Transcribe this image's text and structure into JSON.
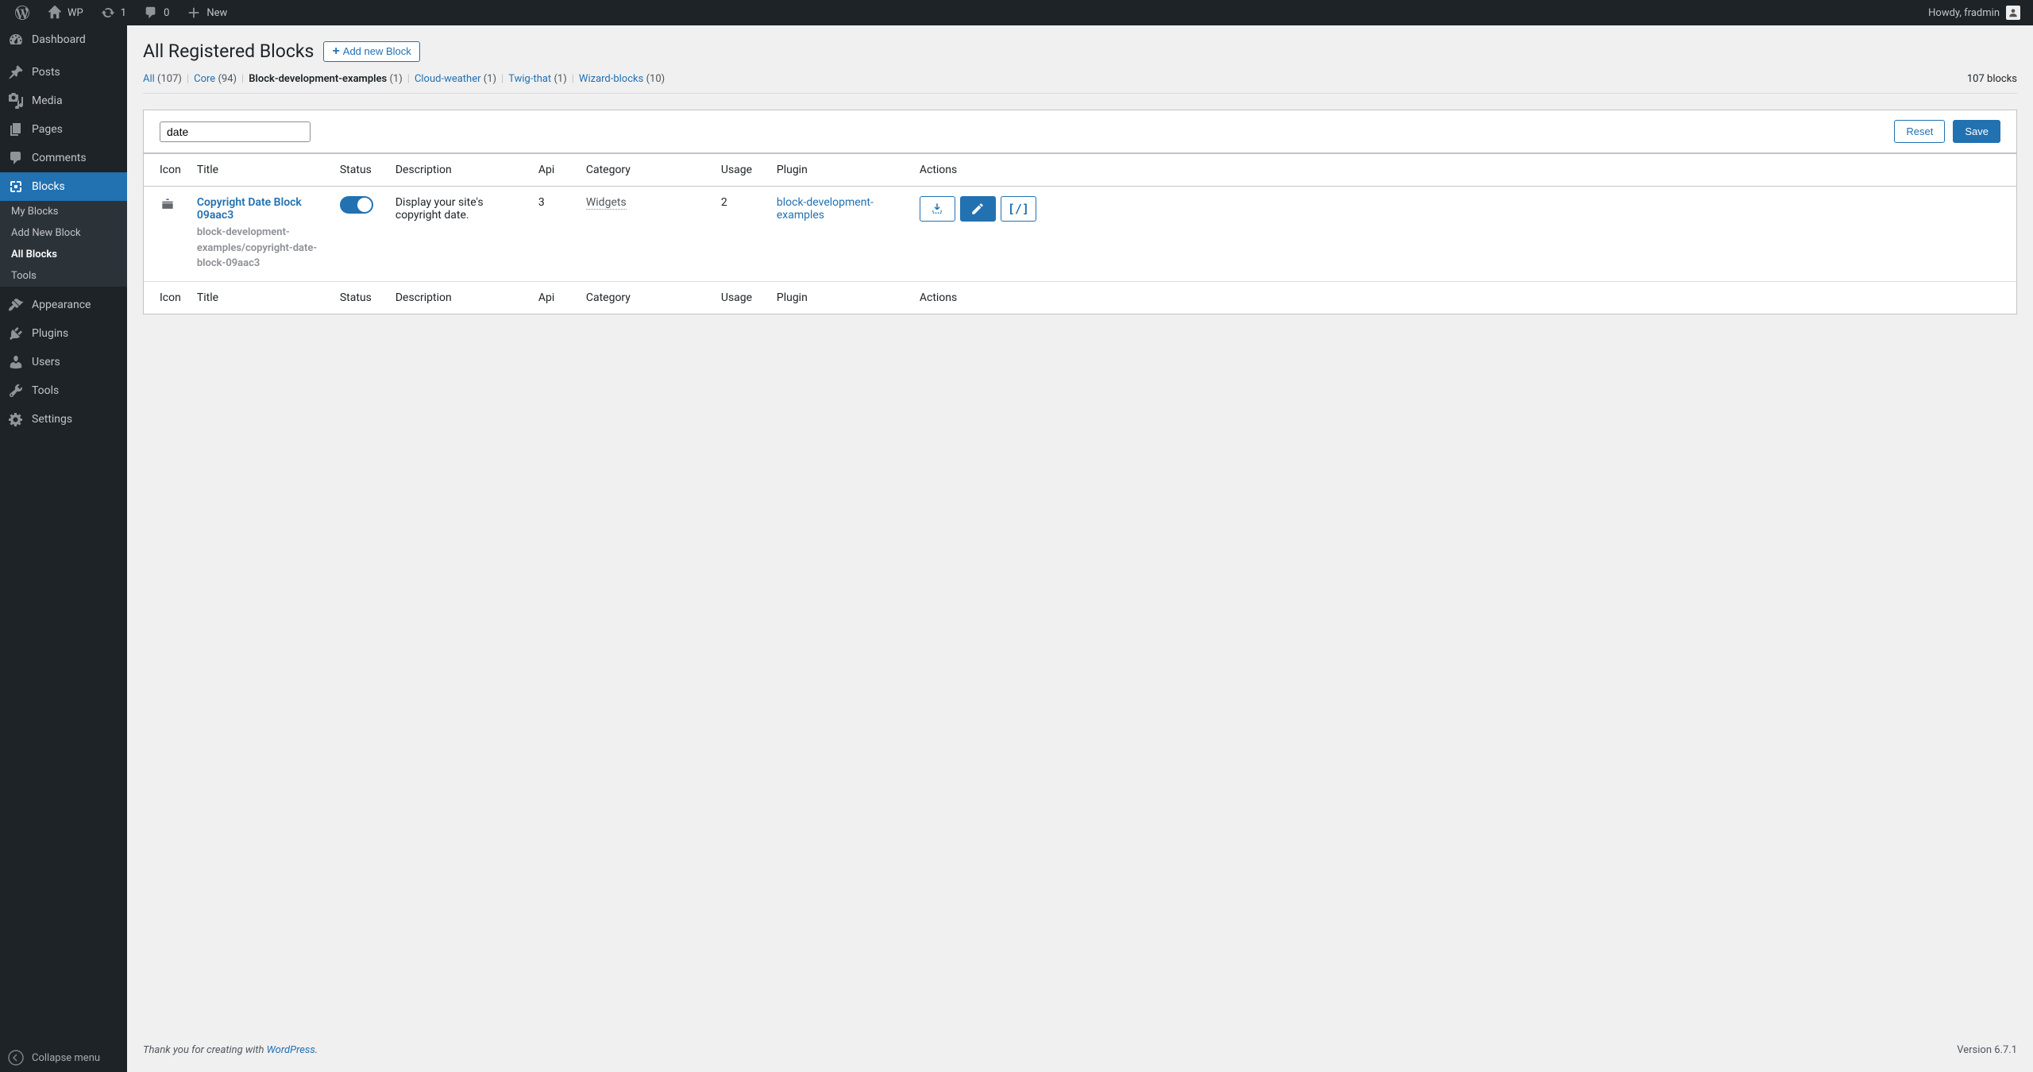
{
  "adminbar": {
    "site_name": "WP",
    "updates_count": "1",
    "comments_count": "0",
    "new_label": "New",
    "howdy": "Howdy, fradmin"
  },
  "sidebar": {
    "items": [
      {
        "label": "Dashboard"
      },
      {
        "label": "Posts"
      },
      {
        "label": "Media"
      },
      {
        "label": "Pages"
      },
      {
        "label": "Comments"
      },
      {
        "label": "Blocks"
      },
      {
        "label": "Appearance"
      },
      {
        "label": "Plugins"
      },
      {
        "label": "Users"
      },
      {
        "label": "Tools"
      },
      {
        "label": "Settings"
      }
    ],
    "submenu": [
      {
        "label": "My Blocks"
      },
      {
        "label": "Add New Block"
      },
      {
        "label": "All Blocks"
      },
      {
        "label": "Tools"
      }
    ],
    "collapse": "Collapse menu"
  },
  "page": {
    "title": "All Registered Blocks",
    "add_button": "Add new Block",
    "total_blocks": "107 blocks"
  },
  "filters": [
    {
      "label": "All",
      "count": "(107)",
      "current": false
    },
    {
      "label": "Core",
      "count": "(94)",
      "current": false
    },
    {
      "label": "Block-development-examples",
      "count": "(1)",
      "current": true
    },
    {
      "label": "Cloud-weather",
      "count": "(1)",
      "current": false
    },
    {
      "label": "Twig-that",
      "count": "(1)",
      "current": false
    },
    {
      "label": "Wizard-blocks",
      "count": "(10)",
      "current": false
    }
  ],
  "search": {
    "value": "date",
    "reset": "Reset",
    "save": "Save"
  },
  "table": {
    "headers": {
      "icon": "Icon",
      "title": "Title",
      "status": "Status",
      "description": "Description",
      "api": "Api",
      "category": "Category",
      "usage": "Usage",
      "plugin": "Plugin",
      "actions": "Actions"
    },
    "rows": [
      {
        "title": "Copyright Date Block 09aac3",
        "slug": "block-development-examples/copyright-date-block-09aac3",
        "description": "Display your site's copyright date.",
        "api": "3",
        "category": "Widgets",
        "usage": "2",
        "plugin": "block-development-examples"
      }
    ]
  },
  "footer": {
    "thanks_prefix": "Thank you for creating with ",
    "thanks_link": "WordPress",
    "thanks_suffix": ".",
    "version": "Version 6.7.1"
  }
}
